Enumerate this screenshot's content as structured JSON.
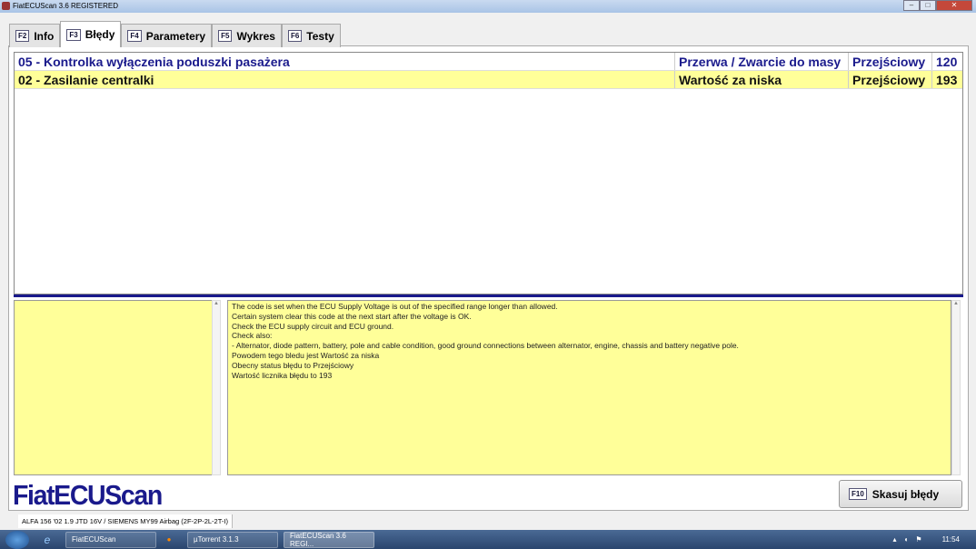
{
  "window": {
    "title": "FiatECUScan 3.6 REGISTERED"
  },
  "tabs": [
    {
      "key": "F2",
      "label": "Info"
    },
    {
      "key": "F3",
      "label": "Błędy"
    },
    {
      "key": "F4",
      "label": "Parametery"
    },
    {
      "key": "F5",
      "label": "Wykres"
    },
    {
      "key": "F6",
      "label": "Testy"
    }
  ],
  "errors": [
    {
      "code": "05 - Kontrolka wyłączenia poduszki pasażera",
      "type": "Przerwa / Zwarcie do masy",
      "status": "Przejściowy",
      "count": "120"
    },
    {
      "code": "02 - Zasilanie centralki",
      "type": "Wartość za niska",
      "status": "Przejściowy",
      "count": "193"
    }
  ],
  "description": [
    "The code is set when the ECU Supply Voltage is out of the specified range longer than allowed.",
    "Certain system clear this code at the next start after the voltage is OK.",
    "Check the ECU supply circuit and ECU ground.",
    "Check also:",
    "- Alternator, diode pattern, battery, pole and cable condition, good ground connections between alternator, engine, chassis and battery negative pole.",
    "Powodem tego bledu jest Wartość za niska",
    "Obecny status błędu to Przejściowy",
    "Wartość licznika błędu to 193"
  ],
  "logo": "FiatECUScan",
  "clear_button": {
    "key": "F10",
    "label": "Skasuj błędy"
  },
  "status_bar": "ALFA 156 '02 1.9 JTD 16V / SIEMENS MY99 Airbag (2F-2P-2L-2T-I)",
  "taskbar": {
    "items": [
      "FiatECUScan",
      "µTorrent 3.1.3",
      "FiatECUScan 3.6 REGI..."
    ],
    "clock": "11:54"
  }
}
